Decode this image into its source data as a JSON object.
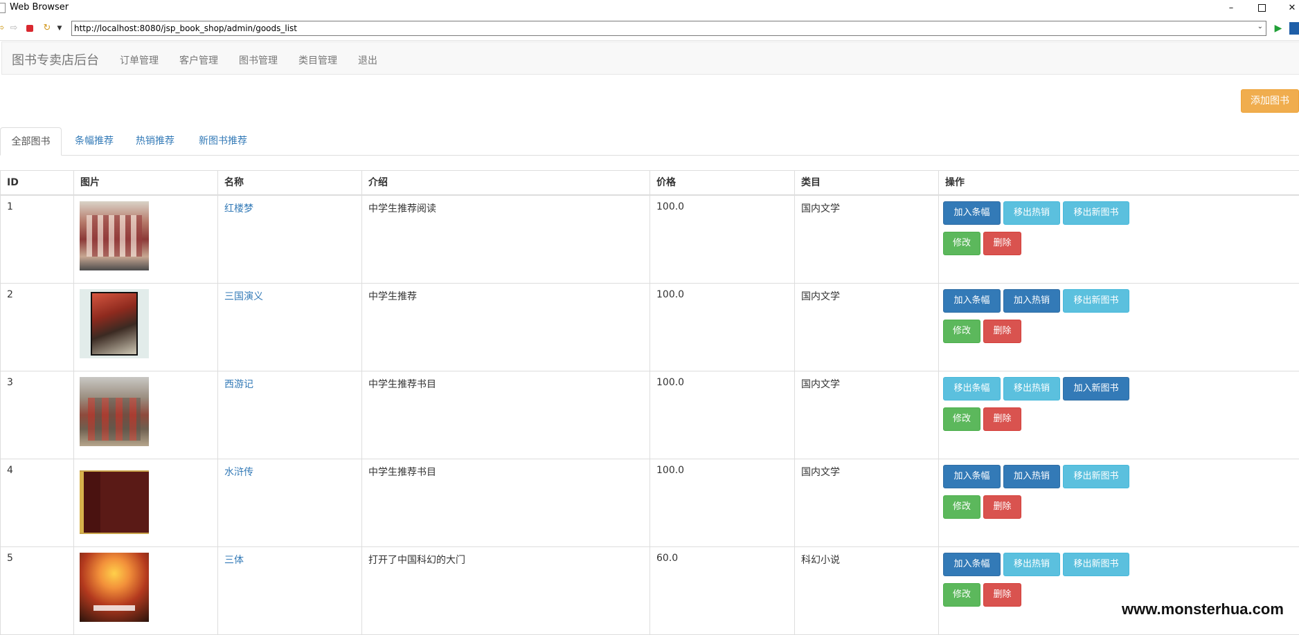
{
  "window": {
    "title": "Web Browser"
  },
  "browser": {
    "url": "http://localhost:8080/jsp_book_shop/admin/goods_list"
  },
  "navbar": {
    "brand": "图书专卖店后台",
    "links": [
      "订单管理",
      "客户管理",
      "图书管理",
      "类目管理",
      "退出"
    ]
  },
  "actions": {
    "add_book": "添加图书"
  },
  "tabs": [
    "全部图书",
    "条幅推荐",
    "热销推荐",
    "新图书推荐"
  ],
  "table": {
    "headers": [
      "ID",
      "图片",
      "名称",
      "介绍",
      "价格",
      "类目",
      "操作"
    ],
    "rows": [
      {
        "id": "1",
        "name": "红楼梦",
        "intro": "中学生推荐阅读",
        "price": "100.0",
        "category": "国内文学",
        "btn_banner": "加入条幅",
        "btn_hot": "移出热销",
        "btn_new": "移出新图书"
      },
      {
        "id": "2",
        "name": "三国演义",
        "intro": "中学生推荐",
        "price": "100.0",
        "category": "国内文学",
        "btn_banner": "加入条幅",
        "btn_hot": "加入热销",
        "btn_new": "移出新图书"
      },
      {
        "id": "3",
        "name": "西游记",
        "intro": "中学生推荐书目",
        "price": "100.0",
        "category": "国内文学",
        "btn_banner": "移出条幅",
        "btn_hot": "移出热销",
        "btn_new": "加入新图书"
      },
      {
        "id": "4",
        "name": "水浒传",
        "intro": "中学生推荐书目",
        "price": "100.0",
        "category": "国内文学",
        "btn_banner": "加入条幅",
        "btn_hot": "加入热销",
        "btn_new": "移出新图书"
      },
      {
        "id": "5",
        "name": "三体",
        "intro": "打开了中国科幻的大门",
        "price": "60.0",
        "category": "科幻小说",
        "btn_banner": "加入条幅",
        "btn_hot": "移出热销",
        "btn_new": "移出新图书"
      }
    ],
    "edit_label": "修改",
    "delete_label": "删除"
  },
  "watermark": "www.monsterhua.com",
  "colors": {
    "primary": "#337ab7",
    "info": "#5bc0de",
    "success": "#5cb85c",
    "danger": "#d9534f",
    "warning": "#f0ad4e"
  }
}
